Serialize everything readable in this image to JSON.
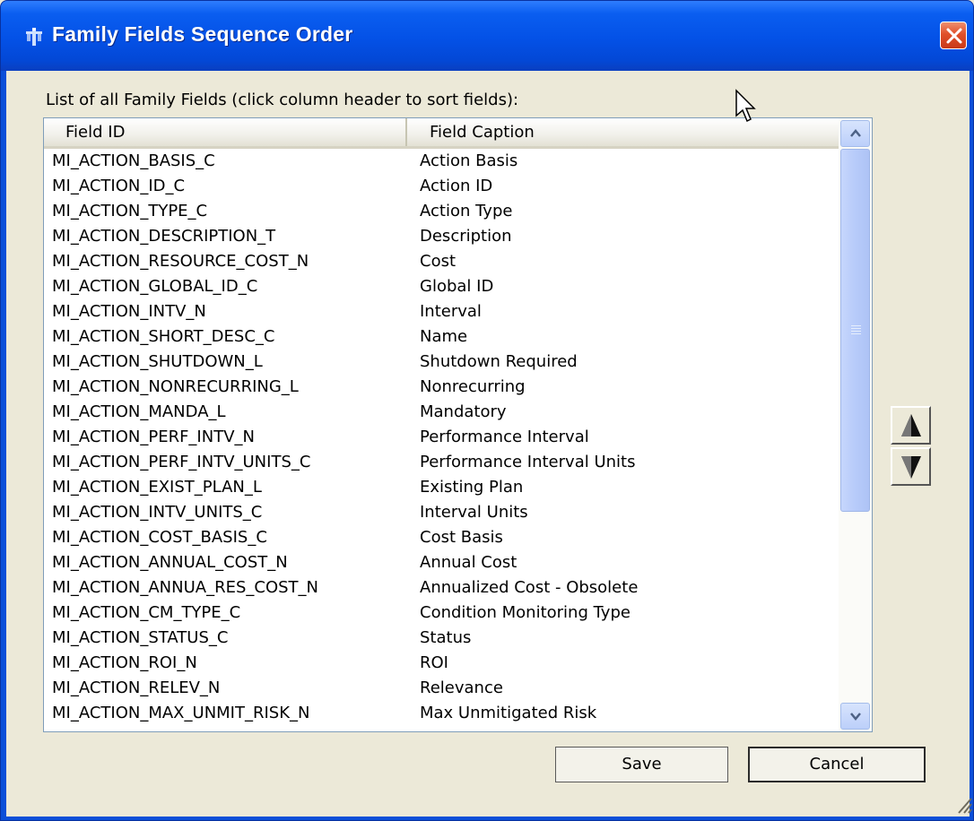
{
  "window": {
    "title": "Family Fields Sequence Order",
    "icons": {
      "app": "family-fields-app-icon",
      "close": "close-x-icon"
    },
    "accent_color": "#0451e6"
  },
  "list": {
    "caption": "List of all Family Fields (click column header to sort fields):",
    "columns": [
      "Field ID",
      "Field Caption"
    ],
    "rows": [
      [
        "MI_ACTION_BASIS_C",
        "Action Basis"
      ],
      [
        "MI_ACTION_ID_C",
        "Action ID"
      ],
      [
        "MI_ACTION_TYPE_C",
        "Action Type"
      ],
      [
        "MI_ACTION_DESCRIPTION_T",
        "Description"
      ],
      [
        "MI_ACTION_RESOURCE_COST_N",
        "Cost"
      ],
      [
        "MI_ACTION_GLOBAL_ID_C",
        "Global ID"
      ],
      [
        "MI_ACTION_INTV_N",
        "Interval"
      ],
      [
        "MI_ACTION_SHORT_DESC_C",
        "Name"
      ],
      [
        "MI_ACTION_SHUTDOWN_L",
        "Shutdown Required"
      ],
      [
        "MI_ACTION_NONRECURRING_L",
        "Nonrecurring"
      ],
      [
        "MI_ACTION_MANDA_L",
        "Mandatory"
      ],
      [
        "MI_ACTION_PERF_INTV_N",
        "Performance Interval"
      ],
      [
        "MI_ACTION_PERF_INTV_UNITS_C",
        "Performance Interval Units"
      ],
      [
        "MI_ACTION_EXIST_PLAN_L",
        "Existing Plan"
      ],
      [
        "MI_ACTION_INTV_UNITS_C",
        "Interval Units"
      ],
      [
        "MI_ACTION_COST_BASIS_C",
        "Cost Basis"
      ],
      [
        "MI_ACTION_ANNUAL_COST_N",
        "Annual Cost"
      ],
      [
        "MI_ACTION_ANNUA_RES_COST_N",
        "Annualized Cost - Obsolete"
      ],
      [
        "MI_ACTION_CM_TYPE_C",
        "Condition Monitoring Type"
      ],
      [
        "MI_ACTION_STATUS_C",
        "Status"
      ],
      [
        "MI_ACTION_ROI_N",
        "ROI"
      ],
      [
        "MI_ACTION_RELEV_N",
        "Relevance"
      ],
      [
        "MI_ACTION_MAX_UNMIT_RISK_N",
        "Max Unmitigated Risk"
      ]
    ],
    "scrollbar": {
      "icons": [
        "scroll-up-icon",
        "scroll-down-icon"
      ]
    }
  },
  "reorder": {
    "icons": [
      "move-up-icon",
      "move-down-icon"
    ]
  },
  "buttons": {
    "save": "Save",
    "cancel": "Cancel"
  }
}
